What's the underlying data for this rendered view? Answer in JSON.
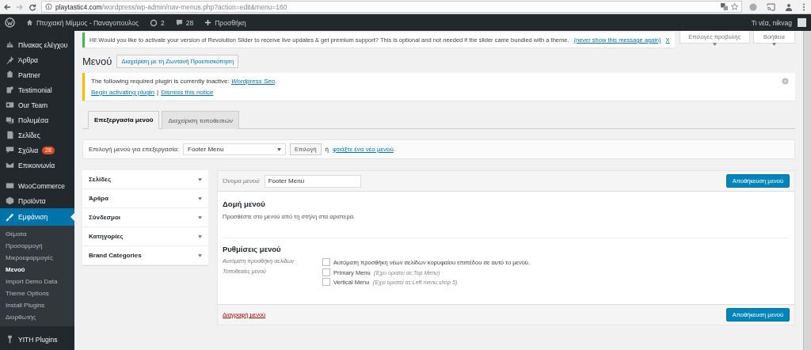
{
  "browser": {
    "url_host": "playtastic4.com",
    "url_path": "/wordpress/wp-admin/nav-menus.php?action=edit&menu=160"
  },
  "admin_bar": {
    "site": "Πτυχιακή Μίμμος - Παναγοπουλος",
    "updates": "2",
    "comments": "28",
    "new": "Προσθήκη",
    "greeting": "Τι νέα, nikvag"
  },
  "sidebar": {
    "items": [
      {
        "label": "Πίνακας ελέγχου",
        "selected": false
      },
      {
        "label": "Άρθρα",
        "selected": false
      },
      {
        "label": "Partner",
        "selected": false
      },
      {
        "label": "Testimonial",
        "selected": false
      },
      {
        "label": "Our Team",
        "selected": false
      },
      {
        "label": "Πολυμέσα",
        "selected": false
      },
      {
        "label": "Σελίδες",
        "selected": false
      },
      {
        "label": "Σχόλια",
        "badge": "28",
        "selected": false
      },
      {
        "label": "Επικοινωνία",
        "selected": false
      },
      {
        "label": "WooCommerce",
        "selected": false
      },
      {
        "label": "Προϊόντα",
        "selected": false
      },
      {
        "label": "Εμφάνιση",
        "selected": true,
        "children": [
          {
            "label": "Θέματα",
            "selected": false
          },
          {
            "label": "Προσαρμογή",
            "selected": false
          },
          {
            "label": "Μικροεφαρμογές",
            "selected": false
          },
          {
            "label": "Μενού",
            "selected": true
          },
          {
            "label": "Import Demo Data",
            "selected": false
          },
          {
            "label": "Theme Options",
            "selected": false
          },
          {
            "label": "Install Plugins",
            "selected": false
          },
          {
            "label": "Διορθωτής",
            "selected": false
          }
        ]
      },
      {
        "label": "YITH Plugins",
        "selected": false
      }
    ]
  },
  "slider_notice": {
    "text": "Hi! Would you like to activate your version of Revolution Slider to receive live updates & get premium support? This is optional and not needed if the slider came bundled with a theme.",
    "link": "(never show this message again)",
    "close": "X"
  },
  "screen_buttons": [
    "Επιλογές προβολής",
    "Βοήθεια"
  ],
  "page": {
    "title": "Μενού",
    "action": "Διαχείριση με τη Ζωντανή Προεπισκόπηση"
  },
  "plugin_notice": {
    "text": "The following required plugin is currently inactive: ",
    "plugin": "Wordpress Seo",
    "end": ".",
    "links": [
      "Begin activating plugin",
      "Dismiss this notice"
    ],
    "separator": "|"
  },
  "tabs": [
    {
      "label": "Επεξεργασία μενού",
      "selected": true
    },
    {
      "label": "Διαχείριση τοποθεσιών",
      "selected": false
    }
  ],
  "select_bar": {
    "label": "Επιλογή μενού για επεξεργασία:",
    "value": "Footer Menu",
    "button": "Επιλογή",
    "or": "ή",
    "create_link": "φτιάξτε ένα νέο μενού",
    "end": "."
  },
  "accordion": [
    {
      "label": "Σελίδες",
      "expanded": false
    },
    {
      "label": "Άρθρα",
      "expanded": false
    },
    {
      "label": "Σύνδεσμοι",
      "expanded": false
    },
    {
      "label": "Κατηγορίες",
      "expanded": false
    },
    {
      "label": "Brand Categories",
      "expanded": false
    }
  ],
  "menu_editor": {
    "name_label": "Όνομα μενού",
    "name_value": "Footer Menu",
    "save": "Αποθήκευση μενού",
    "structure_title": "Δομή μενού",
    "structure_hint": "Προσθέστε στο μενού από τη στήλη στα αριστερά.",
    "settings_title": "Ρυθμίσεις μενού",
    "settings": [
      {
        "label": "Αυτόματη προσθήκη σελίδων",
        "options": [
          {
            "label": "Αυτόματη προσθήκη νέων σελίδων κορυφαίου επιπέδου σε αυτό το μενού.",
            "checked": false
          }
        ]
      },
      {
        "label": "Τοποθεσίες μενού",
        "options": [
          {
            "label": "Primary Menu",
            "note": "(Έχει οριστεί σε:Top Menu)",
            "checked": false
          },
          {
            "label": "Vertical Menu",
            "note": "(Έχει οριστεί σε:Left menu shop 5)",
            "checked": false
          }
        ]
      }
    ],
    "delete": "Διαγραφή μενού",
    "save_bottom": "Αποθήκευση μενού"
  }
}
